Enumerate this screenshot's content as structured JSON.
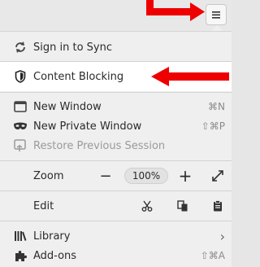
{
  "menu": {
    "sync": {
      "label": "Sign in to Sync"
    },
    "content_blocking": {
      "label": "Content Blocking"
    },
    "new_window": {
      "label": "New Window",
      "shortcut": "⌘N"
    },
    "new_private": {
      "label": "New Private Window",
      "shortcut": "⇧⌘P"
    },
    "restore": {
      "label": "Restore Previous Session"
    },
    "zoom": {
      "label": "Zoom",
      "level": "100%",
      "minus": "−",
      "plus": "+"
    },
    "edit": {
      "label": "Edit"
    },
    "library": {
      "label": "Library",
      "chevron": "›"
    },
    "addons": {
      "label": "Add-ons",
      "shortcut": "⇧⌘A"
    }
  },
  "colors": {
    "annotation_arrow": "#ee0000",
    "highlight": "#ffffff"
  }
}
